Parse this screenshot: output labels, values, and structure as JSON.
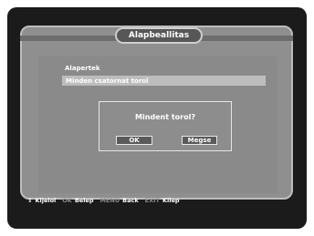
{
  "window": {
    "title": "Alapbeallitas"
  },
  "menu": {
    "label": "Alapertek",
    "selected_item": "Minden csatornat torol"
  },
  "dialog": {
    "message": "Mindent torol?",
    "ok_label": "OK",
    "cancel_label": "Megse"
  },
  "footer": {
    "hints": [
      {
        "key": "⇕",
        "action": "Kijelol"
      },
      {
        "key": "OK",
        "action": "Belep"
      },
      {
        "key": "MENU",
        "action": "Back"
      },
      {
        "key": "EXIT",
        "action": "Kilep"
      }
    ]
  },
  "colors": {
    "screen_bg": "#1b1b1b",
    "panel_bg": "#8a8a8a",
    "highlight": "#bdbdbd",
    "text": "#ffffff"
  }
}
